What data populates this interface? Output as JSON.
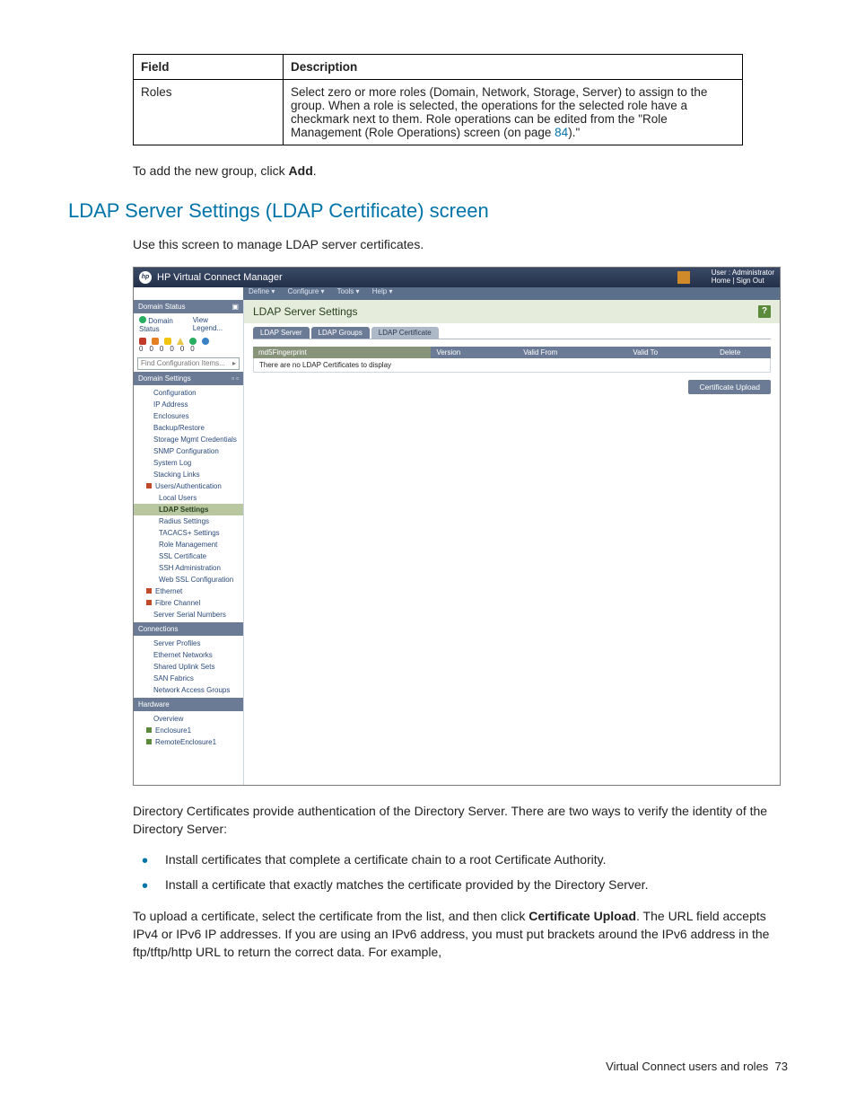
{
  "table": {
    "headers": {
      "field": "Field",
      "description": "Description"
    },
    "row": {
      "field": "Roles",
      "desc_a": "Select zero or more roles (Domain, Network, Storage, Server) to assign to the group. When a role is selected, the operations for the selected role have a checkmark next to them. Role operations can be edited from the \"Role Management (Role Operations) screen (on page ",
      "desc_link": "84",
      "desc_b": ").\""
    }
  },
  "para_add_a": "To add the new group, click ",
  "para_add_bold": "Add",
  "para_add_b": ".",
  "heading": "LDAP Server Settings (LDAP Certificate) screen",
  "para_intro": "Use this screen to manage LDAP server certificates.",
  "vcm": {
    "app_title": "HP Virtual Connect Manager",
    "user_line1": "User : Administrator",
    "user_line2": "Home | Sign Out",
    "menu": {
      "define": "Define ▾",
      "configure": "Configure ▾",
      "tools": "Tools ▾",
      "help": "Help ▾"
    },
    "side": {
      "domain_status_hdr": "Domain Status",
      "domain_status": "Domain Status",
      "view_legend": "View Legend...",
      "counts": [
        "0",
        "0",
        "0",
        "0",
        "0",
        "0"
      ],
      "search_placeholder": "Find Configuration Items...",
      "domain_settings_hdr": "Domain Settings",
      "items_domain": [
        "Configuration",
        "IP Address",
        "Enclosures",
        "Backup/Restore",
        "Storage Mgmt Credentials",
        "SNMP Configuration",
        "System Log",
        "Stacking Links"
      ],
      "users_auth": "Users/Authentication",
      "items_users": [
        "Local Users",
        "LDAP Settings",
        "Radius Settings",
        "TACACS+ Settings",
        "Role Management",
        "SSL Certificate",
        "SSH Administration",
        "Web SSL Configuration"
      ],
      "ethernet": "Ethernet",
      "fibre": "Fibre Channel",
      "serials": "Server Serial Numbers",
      "connections_hdr": "Connections",
      "items_conn": [
        "Server Profiles",
        "Ethernet Networks",
        "Shared Uplink Sets",
        "SAN Fabrics",
        "Network Access Groups"
      ],
      "hardware_hdr": "Hardware",
      "overview": "Overview",
      "enclosure1": "Enclosure1",
      "remote_enclosure1": "RemoteEnclosure1"
    },
    "main": {
      "title": "LDAP Server Settings",
      "tabs": {
        "server": "LDAP Server",
        "groups": "LDAP Groups",
        "cert": "LDAP Certificate"
      },
      "grid": {
        "fp": "md5Fingerprint",
        "ver": "Version",
        "from": "Valid From",
        "to": "Valid To",
        "del": "Delete",
        "empty": "There are no LDAP Certificates to display"
      },
      "upload_btn": "Certificate Upload"
    }
  },
  "para_dir": "Directory Certificates provide authentication of the Directory Server. There are two ways to verify the identity of the Directory Server:",
  "bullets": [
    "Install certificates that complete a certificate chain to a root Certificate Authority.",
    "Install a certificate that exactly matches the certificate provided by the Directory Server."
  ],
  "para_upload_a": "To upload a certificate, select the certificate from the list, and then click ",
  "para_upload_bold": "Certificate Upload",
  "para_upload_b": ". The URL field accepts IPv4 or IPv6 IP addresses. If you are using an IPv6 address, you must put brackets around the IPv6 address in the ftp/tftp/http URL to return the correct data. For example,",
  "footer_text": "Virtual Connect users and roles",
  "footer_page": "73"
}
